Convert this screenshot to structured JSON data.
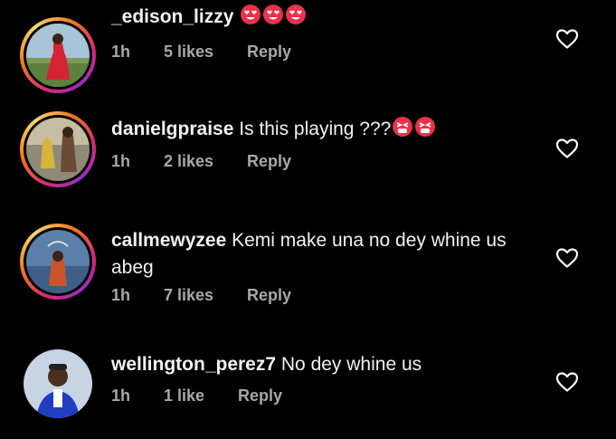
{
  "comments": [
    {
      "username": "_edison_lizzy",
      "text": "",
      "emoji": [
        "heart-eyes-emoji",
        "heart-eyes-emoji",
        "heart-eyes-emoji"
      ],
      "time": "1h",
      "likes": "5 likes",
      "reply": "Reply",
      "avatar_ring": true
    },
    {
      "username": "danielgpraise",
      "text": "Is this playing ???",
      "emoji": [
        "tired-face-emoji",
        "tired-face-emoji"
      ],
      "time": "1h",
      "likes": "2 likes",
      "reply": "Reply",
      "avatar_ring": true
    },
    {
      "username": "callmewyzee",
      "text": "Kemi make una no dey whine us abeg",
      "emoji": [],
      "time": "1h",
      "likes": "7 likes",
      "reply": "Reply",
      "avatar_ring": true
    },
    {
      "username": "wellington_perez7",
      "text": "No dey whine us",
      "emoji": [],
      "time": "1h",
      "likes": "1 like",
      "reply": "Reply",
      "avatar_ring": false
    }
  ],
  "colors": {
    "background": "#000000",
    "text": "#f2f2f2",
    "meta": "#a8a8a8",
    "emoji": "#e8334a"
  },
  "icons": {
    "like": "heart-outline-icon"
  }
}
